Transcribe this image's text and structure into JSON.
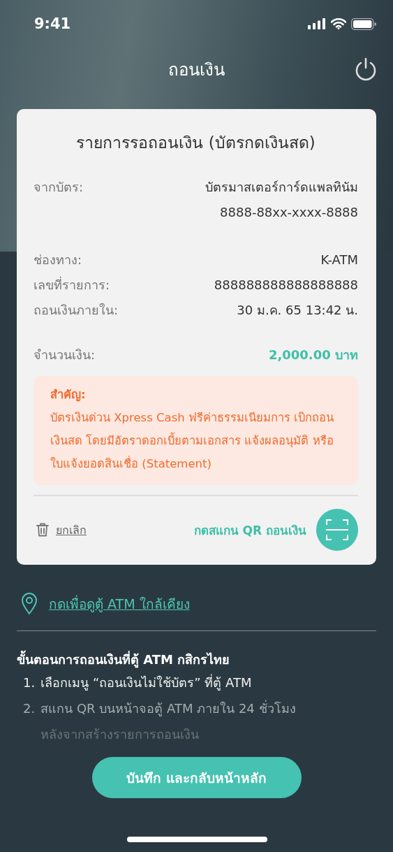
{
  "status_bar": {
    "time": "9:41"
  },
  "header": {
    "title": "ถอนเงิน"
  },
  "card": {
    "title": "รายการรอถอนเงิน (บัตรกดเงินสด)",
    "detail_groups": [
      [
        {
          "label": "จากบัตร:",
          "values": [
            "บัตรมาสเตอร์การ์ดแพลทินัม",
            "8888-88xx-xxxx-8888"
          ]
        }
      ],
      [
        {
          "label": "ช่องทาง:",
          "values": [
            "K-ATM"
          ]
        },
        {
          "label": "เลขที่รายการ:",
          "values": [
            "888888888888888888"
          ]
        },
        {
          "label": "ถอนเงินภายใน:",
          "values": [
            "30 ม.ค. 65 13:42 น."
          ]
        }
      ]
    ],
    "amount": {
      "label": "จำนวนเงิน:",
      "value": "2,000.00 บาท"
    },
    "notice": {
      "title": "สำคัญ:",
      "text": "บัตรเงินด่วน Xpress Cash ฟรีค่าธรรมเนียมการ เบิกถอน เงินสด โดยมีอัตราดอกเบี้ยตามเอกสาร แจ้งผลอนุมัติ หรือ ใบแจ้งยอดสินเชื่อ (Statement)"
    },
    "cancel": "ยกเลิก",
    "scan": "กดสแกน QR ถอนเงิน"
  },
  "atm_link": "กดเพื่อดูตู้ ATM ใกล้เคียง",
  "steps": {
    "title": "ขั้นตอนการถอนเงินที่ตู้ ATM กสิกรไทย",
    "items": [
      {
        "number": "1.",
        "text": "เลือกเมนู “ถอนเงินไม่ใช้บัตร” ที่ตู้ ATM"
      },
      {
        "number": "2.",
        "text": "สแกน QR บนหน้าจอตู้ ATM ภายใน 24 ชั่วโมง",
        "continuation": "หลังจากสร้างรายการถอนเงิน"
      }
    ]
  },
  "primary_button": "บันทึก และกลับหน้าหลัก"
}
